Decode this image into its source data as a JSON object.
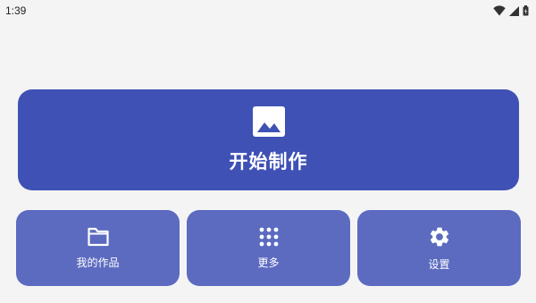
{
  "status_bar": {
    "time": "1:39",
    "icons": [
      "wifi-icon",
      "cellular-signal-icon",
      "battery-icon"
    ]
  },
  "main_action": {
    "label": "开始制作",
    "icon": "image-icon",
    "color": "#3f51b5"
  },
  "shortcuts": [
    {
      "label": "我的作品",
      "icon": "folder-icon"
    },
    {
      "label": "更多",
      "icon": "apps-grid-icon"
    },
    {
      "label": "设置",
      "icon": "gear-icon"
    }
  ],
  "colors": {
    "background": "#f4f4f4",
    "primary": "#3f51b5",
    "secondary": "#5c6bc0",
    "on_primary": "#ffffff"
  }
}
